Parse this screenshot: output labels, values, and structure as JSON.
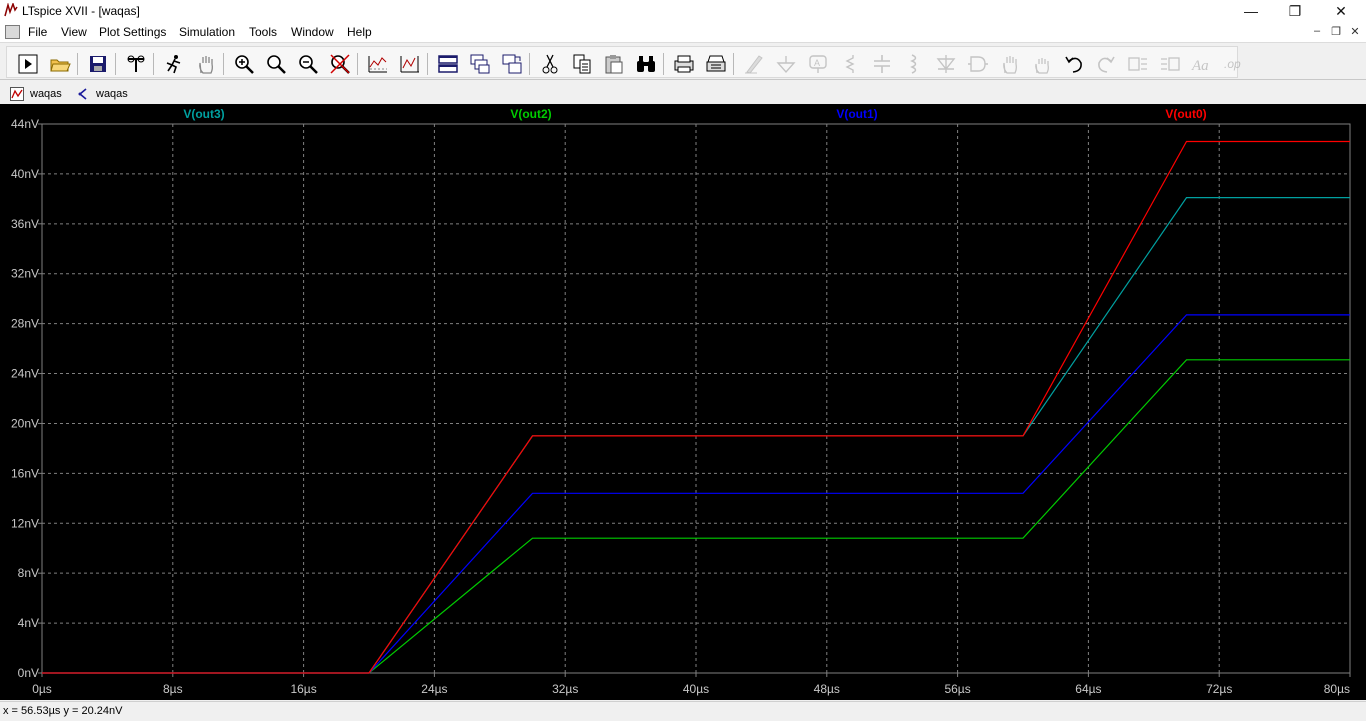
{
  "window": {
    "title": "LTspice XVII - [waqas]",
    "minimize": "—",
    "maximize": "❐",
    "close": "✕"
  },
  "menu": {
    "items": [
      "File",
      "View",
      "Plot Settings",
      "Simulation",
      "Tools",
      "Window",
      "Help"
    ],
    "mdi_minimize": "–",
    "mdi_restore": "❐",
    "mdi_close": "✕"
  },
  "tabs": [
    {
      "label": "waqas",
      "icon": "waveform-icon"
    },
    {
      "label": "waqas",
      "icon": "schematic-icon"
    }
  ],
  "colors": {
    "plot_background": "#000000",
    "grid": "#808080",
    "axis_text": "#c8c8c8",
    "out3": "#00a0a0",
    "out2": "#00cc00",
    "out1": "#0000ff",
    "out0": "#ff0000"
  },
  "chart_data": {
    "type": "line",
    "xlim": [
      0,
      80
    ],
    "ylim": [
      0,
      44
    ],
    "x_ticks": [
      "0µs",
      "8µs",
      "16µs",
      "24µs",
      "32µs",
      "40µs",
      "48µs",
      "56µs",
      "64µs",
      "72µs",
      "80µs"
    ],
    "y_ticks": [
      "0nV",
      "4nV",
      "8nV",
      "12nV",
      "16nV",
      "20nV",
      "24nV",
      "28nV",
      "32nV",
      "36nV",
      "40nV",
      "44nV"
    ],
    "grid": true,
    "series": [
      {
        "name": "V(out3)",
        "color": "#00a0a0",
        "x": [
          0,
          20,
          30,
          60,
          70,
          80
        ],
        "y": [
          0,
          0,
          19,
          19,
          38.1,
          38.1
        ]
      },
      {
        "name": "V(out2)",
        "color": "#00cc00",
        "x": [
          0,
          20,
          30,
          60,
          70,
          80
        ],
        "y": [
          0,
          0,
          10.8,
          10.8,
          25.1,
          25.1
        ]
      },
      {
        "name": "V(out1)",
        "color": "#0000ff",
        "x": [
          0,
          20,
          30,
          60,
          70,
          80
        ],
        "y": [
          0,
          0,
          14.4,
          14.4,
          28.7,
          28.7
        ]
      },
      {
        "name": "V(out0)",
        "color": "#ff0000",
        "x": [
          0,
          20,
          30,
          60,
          70,
          80
        ],
        "y": [
          0,
          0,
          19,
          19,
          42.6,
          42.6
        ]
      }
    ]
  },
  "status": {
    "cursor": "x = 56.53µs   y = 20.24nV"
  }
}
